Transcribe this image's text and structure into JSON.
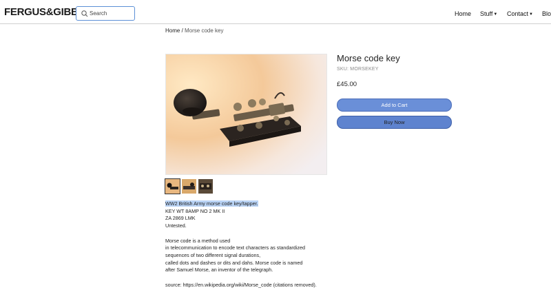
{
  "header": {
    "logo": "FERGUS&GIBBS",
    "search_placeholder": "Search",
    "nav": [
      {
        "label": "Home",
        "caret": false
      },
      {
        "label": "Stuff",
        "caret": true
      },
      {
        "label": "Contact",
        "caret": true
      },
      {
        "label": "Blo",
        "caret": true
      }
    ]
  },
  "breadcrumb": {
    "home": "Home",
    "separator": " / ",
    "current": "Morse code key"
  },
  "product": {
    "title": "Morse code key",
    "sku": "SKU: MORSEKEY",
    "price": "£45.00",
    "add_to_cart": "Add to Cart",
    "buy_now": "Buy Now",
    "thumbnail_count": 3,
    "selected_thumbnail": 1
  },
  "description": {
    "highlighted": "WW2 British Army morse code key/tapper.",
    "lines_1": [
      "KEY WT 8AMP NO 2  MK II",
      "ZA 2869 LMK",
      "Untested."
    ],
    "lines_2": [
      "Morse code is a method used",
      "in telecommunication to encode text characters as standardized",
      "sequences of two different signal durations,",
      "called dots and dashes or dits and dahs. Morse code is named",
      "after Samuel Morse, an inventor of the telegraph."
    ],
    "source": "source: https://en.wikipedia.org/wiki/Morse_code (citations removed)."
  },
  "colors": {
    "button": "#6a8fd8",
    "search_border": "#5b8fd6",
    "highlight": "#b9d3f5"
  }
}
